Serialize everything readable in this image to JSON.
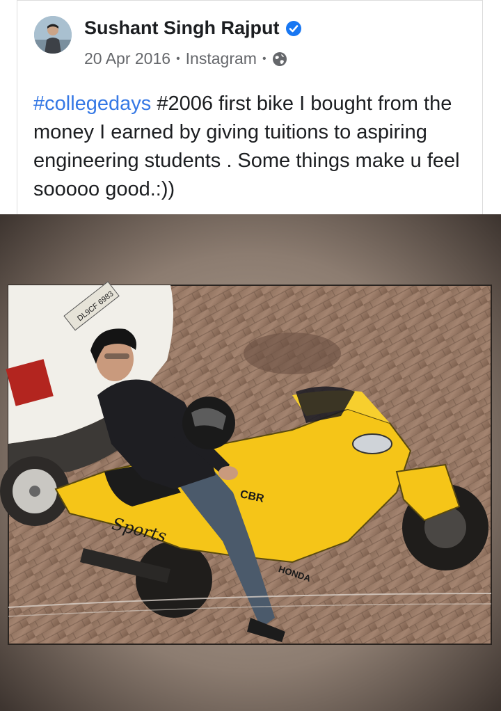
{
  "post": {
    "author": "Sushant Singh Rajput",
    "verified_icon": "verified-badge-icon",
    "date": "20 Apr 2016",
    "separator": "•",
    "source": "Instagram",
    "privacy_icon": "globe-icon",
    "text_hashtag": "#collegedays",
    "text_body": " #2006  first bike  I bought from the money I earned by giving tuitions to aspiring engineering students . Some things make u feel sooooo good.:))"
  },
  "photo": {
    "plate_text": "DL9CF 6983",
    "bike_brand": "HONDA",
    "bike_decal": "Sports",
    "bike_logo": "CBR"
  },
  "colors": {
    "accent_blue": "#3578e5",
    "verified_blue": "#1877f2",
    "bike_yellow": "#f5c518"
  }
}
